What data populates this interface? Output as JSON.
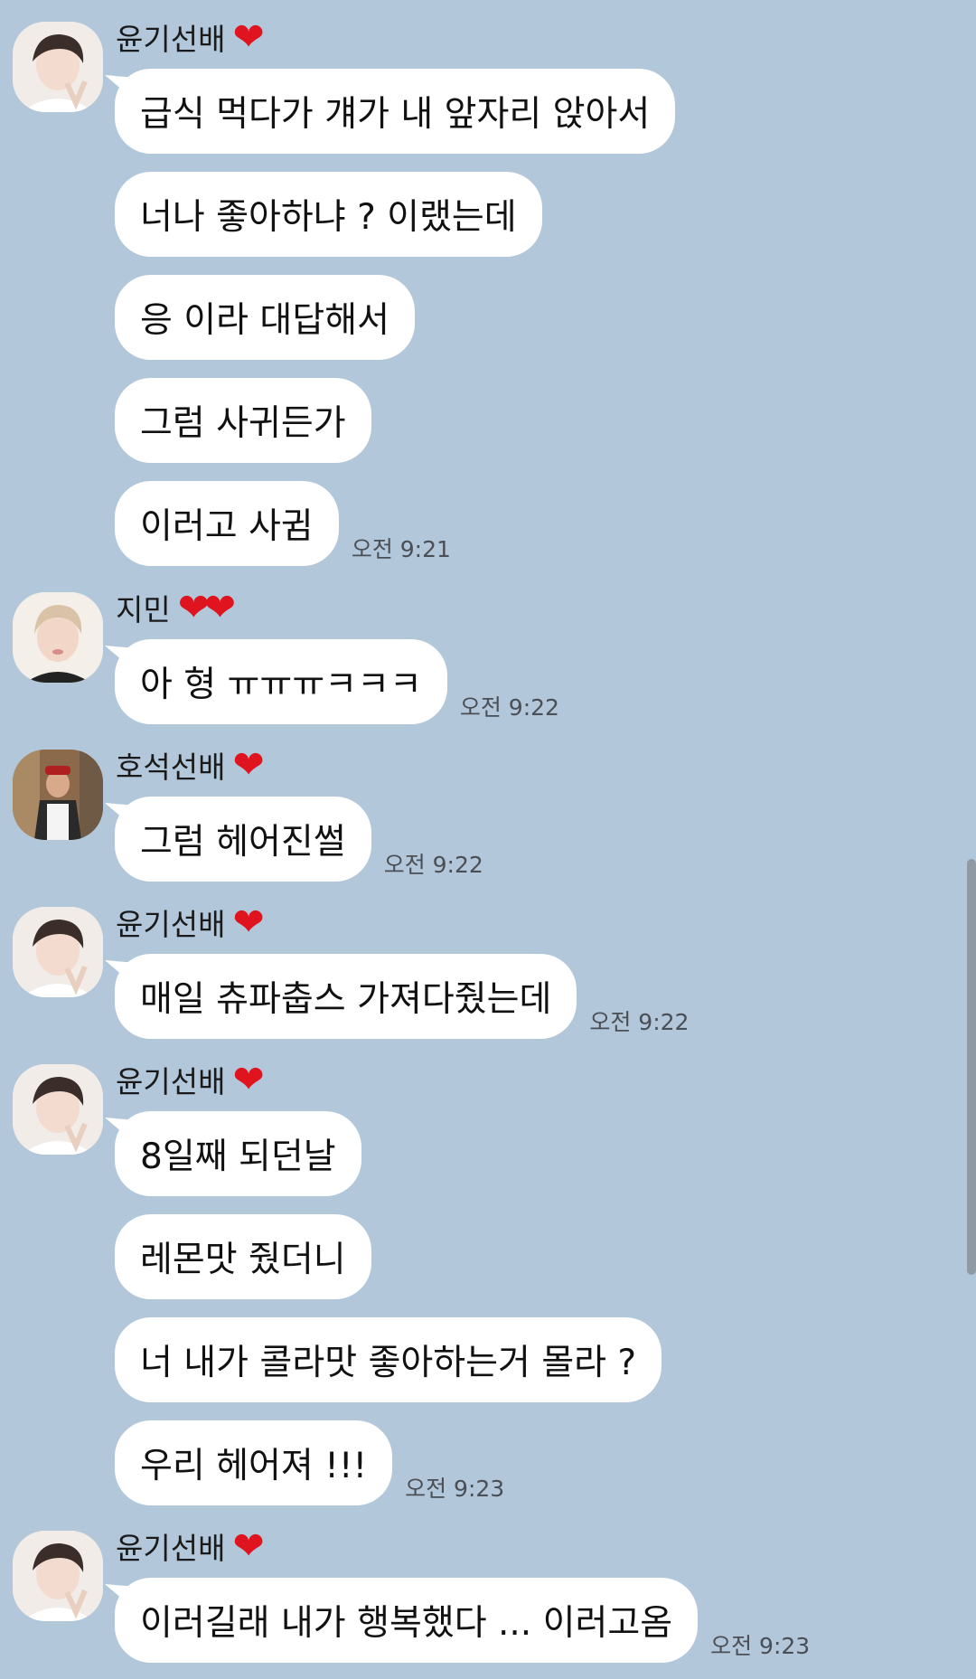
{
  "colors": {
    "background": "#b2c7d9",
    "bubble": "#ffffff",
    "heart": "#e0141e",
    "time": "#4a4f55"
  },
  "groups": [
    {
      "sender": "윤기선배",
      "hearts": "❤",
      "avatar": "profile-photo-yoongi",
      "messages": [
        {
          "text": "급식 먹다가 걔가 내 앞자리 앉아서",
          "time": ""
        },
        {
          "text": "너나 좋아하냐 ? 이랬는데",
          "time": ""
        },
        {
          "text": "응 이라 대답해서",
          "time": ""
        },
        {
          "text": "그럼 사귀든가",
          "time": ""
        },
        {
          "text": "이러고 사귐",
          "time": "오전 9:21"
        }
      ]
    },
    {
      "sender": "지민",
      "hearts": "❤❤",
      "avatar": "profile-photo-jimin",
      "messages": [
        {
          "text": "아 형 ㅠㅠㅠㅋㅋㅋ",
          "time": "오전 9:22"
        }
      ]
    },
    {
      "sender": "호석선배",
      "hearts": "❤",
      "avatar": "profile-photo-hoseok",
      "messages": [
        {
          "text": "그럼 헤어진썰",
          "time": "오전 9:22"
        }
      ]
    },
    {
      "sender": "윤기선배",
      "hearts": "❤",
      "avatar": "profile-photo-yoongi",
      "messages": [
        {
          "text": "매일 츄파춥스 가져다줬는데",
          "time": "오전 9:22"
        }
      ]
    },
    {
      "sender": "윤기선배",
      "hearts": "❤",
      "avatar": "profile-photo-yoongi",
      "messages": [
        {
          "text": "8일째 되던날",
          "time": ""
        },
        {
          "text": "레몬맛 줬더니",
          "time": ""
        },
        {
          "text": "너 내가 콜라맛 좋아하는거 몰라 ?",
          "time": ""
        },
        {
          "text": "우리 헤어져 !!!",
          "time": "오전 9:23"
        }
      ]
    },
    {
      "sender": "윤기선배",
      "hearts": "❤",
      "avatar": "profile-photo-yoongi",
      "messages": [
        {
          "text": "이러길래 내가 행복했다 ...  이러고옴",
          "time": "오전 9:23"
        }
      ]
    }
  ]
}
